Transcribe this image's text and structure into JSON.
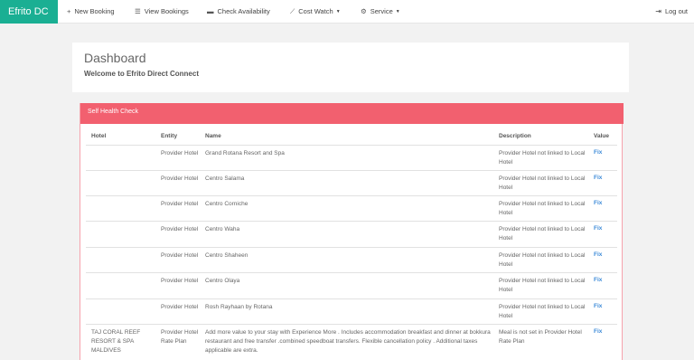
{
  "nav": {
    "brand": "Efrito DC",
    "items": [
      {
        "label": "New Booking",
        "icon": "+"
      },
      {
        "label": "View Bookings",
        "icon": "☰"
      },
      {
        "label": "Check Availability",
        "icon": "▬"
      },
      {
        "label": "Cost Watch",
        "icon": "⟋"
      },
      {
        "label": "Service",
        "icon": "⚙"
      }
    ],
    "logout": "Log out"
  },
  "dashboard": {
    "title": "Dashboard",
    "subtitle": "Welcome to Efrito Direct Connect"
  },
  "panel": {
    "title": "Self Health Check",
    "columns": [
      "Hotel",
      "Entity",
      "Name",
      "Description",
      "Value"
    ],
    "rows": [
      {
        "hotel": "",
        "entity": "Provider Hotel",
        "name": "Grand Rotana Resort and Spa",
        "description": "Provider Hotel not linked to Local Hotel",
        "value": "Fix"
      },
      {
        "hotel": "",
        "entity": "Provider Hotel",
        "name": "Centro Salama",
        "description": "Provider Hotel not linked to Local Hotel",
        "value": "Fix"
      },
      {
        "hotel": "",
        "entity": "Provider Hotel",
        "name": "Centro Corniche",
        "description": "Provider Hotel not linked to Local Hotel",
        "value": "Fix"
      },
      {
        "hotel": "",
        "entity": "Provider Hotel",
        "name": "Centro Waha",
        "description": "Provider Hotel not linked to Local Hotel",
        "value": "Fix"
      },
      {
        "hotel": "",
        "entity": "Provider Hotel",
        "name": "Centro Shaheen",
        "description": "Provider Hotel not linked to Local Hotel",
        "value": "Fix"
      },
      {
        "hotel": "",
        "entity": "Provider Hotel",
        "name": "Centro Olaya",
        "description": "Provider Hotel not linked to Local Hotel",
        "value": "Fix"
      },
      {
        "hotel": "",
        "entity": "Provider Hotel",
        "name": "Rosh Rayhaan by Rotana",
        "description": "Provider Hotel not linked to Local Hotel",
        "value": "Fix"
      },
      {
        "hotel": "TAJ CORAL REEF RESORT & SPA MALDIVES",
        "entity": "Provider Hotel Rate Plan",
        "name": "Add more value to your stay with Experience More . Includes accommodation breakfast and dinner at bokkura restaurant and free transfer .combined speedboat transfers. Flexible cancellation policy . Additional taxes applicable are extra.",
        "description": "Meal is not set in Provider Hotel Rate Plan",
        "value": "Fix"
      }
    ]
  }
}
